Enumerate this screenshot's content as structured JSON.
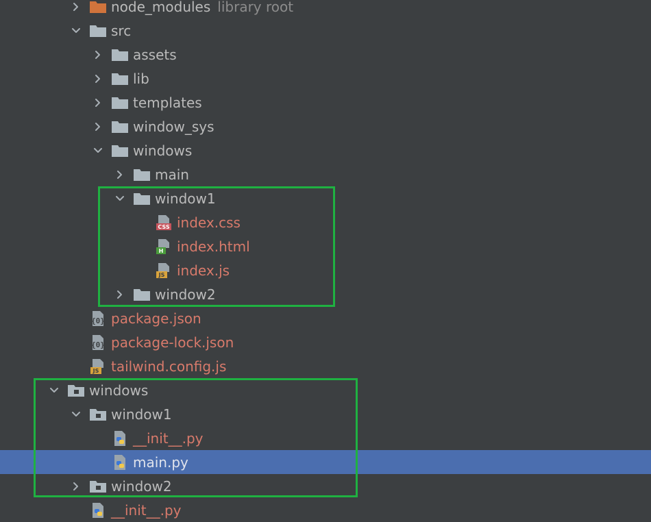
{
  "colors": {
    "background": "#3c3f41",
    "selection": "#4b6eaf",
    "text": "#bbbbbb",
    "modified_text": "#d87a6b",
    "folder": "#aeb9c0",
    "highlight_border": "#1fb141"
  },
  "tree": [
    {
      "label": "node_modules",
      "hint": "library root",
      "icon": "folder-orange-icon",
      "chevron": "right",
      "indent": 0,
      "modified": false
    },
    {
      "label": "src",
      "icon": "folder-icon",
      "chevron": "down",
      "indent": 0,
      "modified": false
    },
    {
      "label": "assets",
      "icon": "folder-icon",
      "chevron": "right",
      "indent": 1,
      "modified": false
    },
    {
      "label": "lib",
      "icon": "folder-icon",
      "chevron": "right",
      "indent": 1,
      "modified": false
    },
    {
      "label": "templates",
      "icon": "folder-icon",
      "chevron": "right",
      "indent": 1,
      "modified": false
    },
    {
      "label": "window_sys",
      "icon": "folder-icon",
      "chevron": "right",
      "indent": 1,
      "modified": false
    },
    {
      "label": "windows",
      "icon": "folder-icon",
      "chevron": "down",
      "indent": 1,
      "modified": false
    },
    {
      "label": "main",
      "icon": "folder-icon",
      "chevron": "right",
      "indent": 2,
      "modified": false
    },
    {
      "label": "window1",
      "icon": "folder-icon",
      "chevron": "down",
      "indent": 2,
      "modified": false
    },
    {
      "label": "index.css",
      "icon": "css-file-icon",
      "chevron": "none",
      "indent": 3,
      "modified": true
    },
    {
      "label": "index.html",
      "icon": "html-file-icon",
      "chevron": "none",
      "indent": 3,
      "modified": true
    },
    {
      "label": "index.js",
      "icon": "js-file-icon",
      "chevron": "none",
      "indent": 3,
      "modified": true
    },
    {
      "label": "window2",
      "icon": "folder-icon",
      "chevron": "right",
      "indent": 2,
      "modified": false
    },
    {
      "label": "package.json",
      "icon": "json-file-icon",
      "chevron": "none",
      "indent": 0,
      "modified": true
    },
    {
      "label": "package-lock.json",
      "icon": "json-file-icon",
      "chevron": "none",
      "indent": 0,
      "modified": true
    },
    {
      "label": "tailwind.config.js",
      "icon": "js-file-icon",
      "chevron": "none",
      "indent": 0,
      "modified": true
    },
    {
      "label": "windows",
      "icon": "package-folder-icon",
      "chevron": "down",
      "indent": -1,
      "modified": false
    },
    {
      "label": "window1",
      "icon": "package-folder-icon",
      "chevron": "down",
      "indent": 0,
      "modified": false
    },
    {
      "label": "__init__.py",
      "icon": "python-file-icon",
      "chevron": "none",
      "indent": 1,
      "modified": true
    },
    {
      "label": "main.py",
      "icon": "python-file-icon",
      "chevron": "none",
      "indent": 1,
      "modified": false,
      "selected": true
    },
    {
      "label": "window2",
      "icon": "package-folder-icon",
      "chevron": "right",
      "indent": 0,
      "modified": false
    },
    {
      "label": "__init__.py",
      "icon": "python-file-icon",
      "chevron": "none",
      "indent": 0,
      "modified": true
    }
  ]
}
